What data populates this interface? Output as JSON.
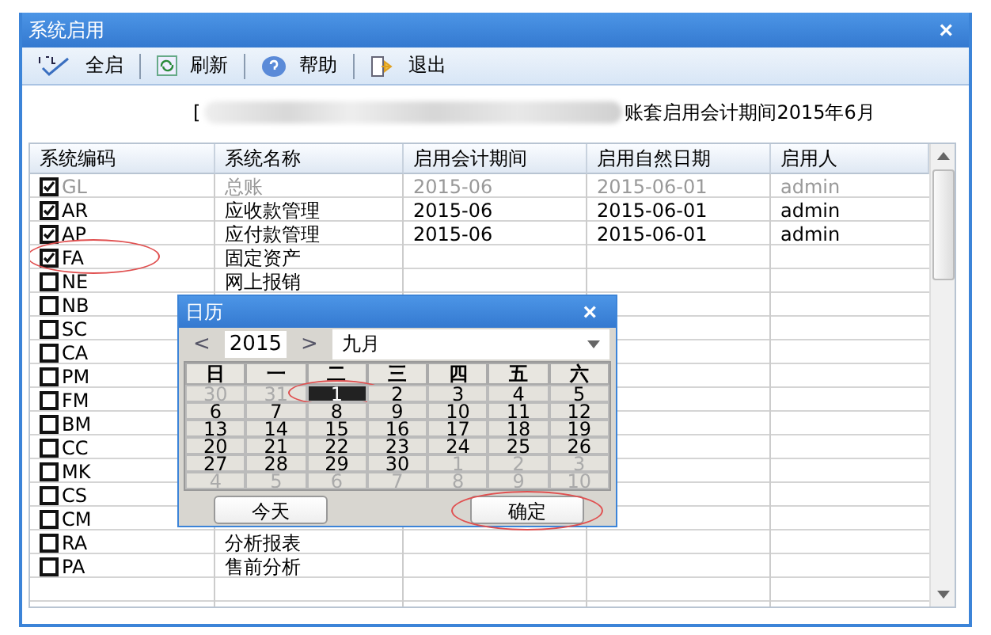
{
  "window": {
    "title": "系统启用",
    "close": "×"
  },
  "toolbar": [
    {
      "kind": "all",
      "label": "全启"
    },
    {
      "kind": "refresh",
      "label": "刷新"
    },
    {
      "kind": "help",
      "label": "帮助"
    },
    {
      "kind": "exit",
      "label": "退出"
    }
  ],
  "header": {
    "prefix": "[",
    "text": "账套启用会计期间2015年6月"
  },
  "table": {
    "columns": [
      "系统编码",
      "系统名称",
      "启用会计期间",
      "启用自然日期",
      "启用人"
    ],
    "rows": [
      {
        "code": "GL",
        "name": "总账",
        "period": "2015-06",
        "date": "2015-06-01",
        "user": "admin",
        "checked": true,
        "disabled": true,
        "circled": false
      },
      {
        "code": "AR",
        "name": "应收款管理",
        "period": "2015-06",
        "date": "2015-06-01",
        "user": "admin",
        "checked": true,
        "disabled": false,
        "circled": false
      },
      {
        "code": "AP",
        "name": "应付款管理",
        "period": "2015-06",
        "date": "2015-06-01",
        "user": "admin",
        "checked": true,
        "disabled": false,
        "circled": false
      },
      {
        "code": "FA",
        "name": "固定资产",
        "checked": true,
        "disabled": false,
        "circled": true
      },
      {
        "code": "NE",
        "name": "网上报销",
        "checked": false,
        "disabled": false,
        "circled": false
      },
      {
        "code": "NB",
        "checked": false,
        "disabled": false,
        "circled": false
      },
      {
        "code": "SC",
        "checked": false,
        "disabled": false,
        "circled": false
      },
      {
        "code": "CA",
        "checked": false,
        "disabled": false,
        "circled": false
      },
      {
        "code": "PM",
        "checked": false,
        "disabled": false,
        "circled": false
      },
      {
        "code": "FM",
        "checked": false,
        "disabled": false,
        "circled": false
      },
      {
        "code": "BM",
        "checked": false,
        "disabled": false,
        "circled": false
      },
      {
        "code": "CC",
        "checked": false,
        "disabled": false,
        "circled": false
      },
      {
        "code": "MK",
        "checked": false,
        "disabled": false,
        "circled": false
      },
      {
        "code": "CS",
        "checked": false,
        "disabled": false,
        "circled": false
      },
      {
        "code": "CM",
        "checked": false,
        "disabled": false,
        "circled": false
      },
      {
        "code": "RA",
        "name": "分析报表",
        "checked": false,
        "disabled": false,
        "circled": false
      },
      {
        "code": "PA",
        "name": "售前分析",
        "checked": false,
        "disabled": false,
        "circled": false
      }
    ]
  },
  "calendar": {
    "title": "日历",
    "close": "×",
    "prev": "<",
    "year": "2015",
    "next": ">",
    "month": "九月",
    "weekdays": [
      "日",
      "一",
      "二",
      "三",
      "四",
      "五",
      "六"
    ],
    "days": [
      {
        "label": "30",
        "muted": true,
        "selected": false
      },
      {
        "label": "31",
        "muted": true,
        "selected": false
      },
      {
        "label": "1",
        "muted": false,
        "selected": true
      },
      {
        "label": "2",
        "muted": false,
        "selected": false
      },
      {
        "label": "3",
        "muted": false,
        "selected": false
      },
      {
        "label": "4",
        "muted": false,
        "selected": false
      },
      {
        "label": "5",
        "muted": false,
        "selected": false
      },
      {
        "label": "6",
        "muted": false,
        "selected": false
      },
      {
        "label": "7",
        "muted": false,
        "selected": false
      },
      {
        "label": "8",
        "muted": false,
        "selected": false
      },
      {
        "label": "9",
        "muted": false,
        "selected": false
      },
      {
        "label": "10",
        "muted": false,
        "selected": false
      },
      {
        "label": "11",
        "muted": false,
        "selected": false
      },
      {
        "label": "12",
        "muted": false,
        "selected": false
      },
      {
        "label": "13",
        "muted": false,
        "selected": false
      },
      {
        "label": "14",
        "muted": false,
        "selected": false
      },
      {
        "label": "15",
        "muted": false,
        "selected": false
      },
      {
        "label": "16",
        "muted": false,
        "selected": false
      },
      {
        "label": "17",
        "muted": false,
        "selected": false
      },
      {
        "label": "18",
        "muted": false,
        "selected": false
      },
      {
        "label": "19",
        "muted": false,
        "selected": false
      },
      {
        "label": "20",
        "muted": false,
        "selected": false
      },
      {
        "label": "21",
        "muted": false,
        "selected": false
      },
      {
        "label": "22",
        "muted": false,
        "selected": false
      },
      {
        "label": "23",
        "muted": false,
        "selected": false
      },
      {
        "label": "24",
        "muted": false,
        "selected": false
      },
      {
        "label": "25",
        "muted": false,
        "selected": false
      },
      {
        "label": "26",
        "muted": false,
        "selected": false
      },
      {
        "label": "27",
        "muted": false,
        "selected": false
      },
      {
        "label": "28",
        "muted": false,
        "selected": false
      },
      {
        "label": "29",
        "muted": false,
        "selected": false
      },
      {
        "label": "30",
        "muted": false,
        "selected": false
      },
      {
        "label": "1",
        "muted": true,
        "selected": false
      },
      {
        "label": "2",
        "muted": true,
        "selected": false
      },
      {
        "label": "3",
        "muted": true,
        "selected": false
      },
      {
        "label": "4",
        "muted": true,
        "selected": false
      },
      {
        "label": "5",
        "muted": true,
        "selected": false
      },
      {
        "label": "6",
        "muted": true,
        "selected": false
      },
      {
        "label": "7",
        "muted": true,
        "selected": false
      },
      {
        "label": "8",
        "muted": true,
        "selected": false
      },
      {
        "label": "9",
        "muted": true,
        "selected": false
      },
      {
        "label": "10",
        "muted": true,
        "selected": false
      }
    ],
    "buttons": [
      {
        "label": "今天",
        "circled": false
      },
      {
        "label": "确定",
        "circled": true
      }
    ]
  }
}
